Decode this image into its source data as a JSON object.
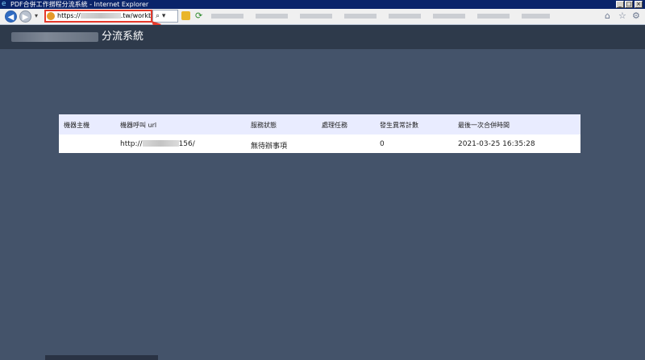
{
  "window": {
    "title": "PDF合併工作撈程分流系統 - Internet Explorer",
    "controls": [
      "_",
      "□",
      "×"
    ]
  },
  "browser": {
    "address_url": "https://",
    "address_url_suffix": ".tw/workbench",
    "right_icons": [
      "home-icon",
      "star-icon",
      "gear-icon"
    ]
  },
  "app": {
    "header_title": "分流系統"
  },
  "table": {
    "headers": [
      "機器主機",
      "機器呼叫 url",
      "服務狀態",
      "處理任務",
      "發生異常計數",
      "最後一次合併時間"
    ],
    "rows": [
      {
        "host": "",
        "url_prefix": "http://",
        "url_suffix": "156/",
        "status": "無待辦事項",
        "task": "",
        "error_count": "0",
        "last_merge_time": "2021-03-25 16:35:28"
      }
    ]
  },
  "colors": {
    "background": "#44536a",
    "header_bar": "#2e3a4b",
    "table_header": "#e9ecff",
    "annotation": "#e53a2c"
  }
}
